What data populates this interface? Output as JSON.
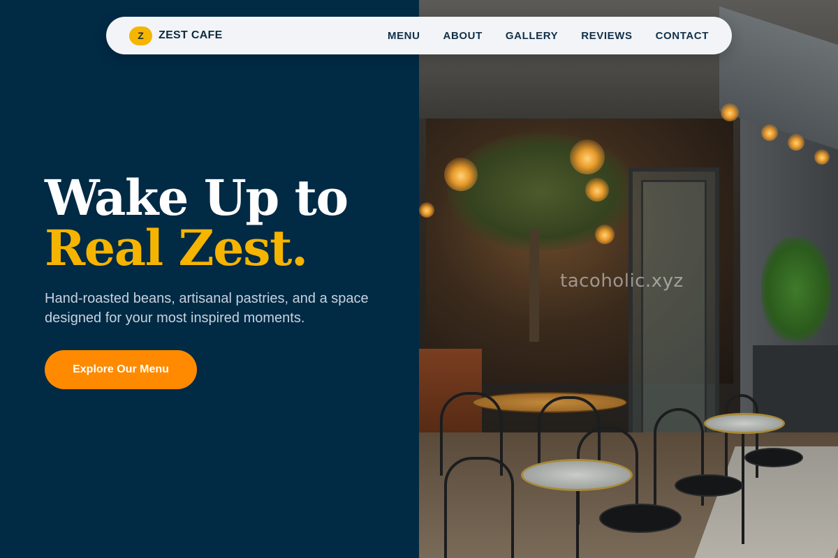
{
  "brand": {
    "badge": "Z",
    "name": "ZEST CAFE"
  },
  "nav": {
    "items": [
      "MENU",
      "ABOUT",
      "GALLERY",
      "REVIEWS",
      "CONTACT"
    ]
  },
  "hero": {
    "headline_line1": "Wake Up to",
    "headline_line2": "Real Zest.",
    "subtext": "Hand-roasted beans, artisanal pastries, and a space designed for your most inspired moments.",
    "cta_label": "Explore Our Menu"
  },
  "watermark": "tacoholic.xyz",
  "colors": {
    "background": "#012a45",
    "accent_yellow": "#f5b400",
    "cta_orange": "#ff8a00",
    "navbar": "#f2f4f7"
  }
}
